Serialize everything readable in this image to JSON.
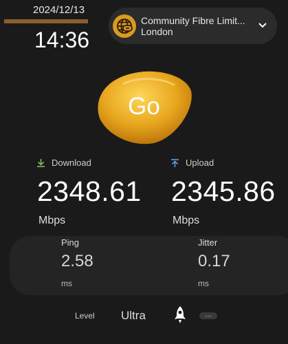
{
  "status": {
    "date": "2024/12/13",
    "time": "14:36"
  },
  "server": {
    "name": "Community Fibre Limit...",
    "city": "London",
    "icon": "globe-link-icon"
  },
  "go_button": {
    "label": "Go",
    "color": "#e0a21c"
  },
  "download": {
    "label": "Download",
    "value": "2348.61",
    "unit": "Mbps",
    "icon": "download-arrow-icon",
    "icon_color": "#7fbf5a"
  },
  "upload": {
    "label": "Upload",
    "value": "2345.86",
    "unit": "Mbps",
    "icon": "upload-arrow-icon",
    "icon_color": "#5aa0e0"
  },
  "ping": {
    "label": "Ping",
    "value": "2.58",
    "unit": "ms"
  },
  "jitter": {
    "label": "Jitter",
    "value": "0.17",
    "unit": "ms"
  },
  "footer": {
    "level_label": "Level",
    "level_value": "Ultra",
    "more_label": "···"
  }
}
